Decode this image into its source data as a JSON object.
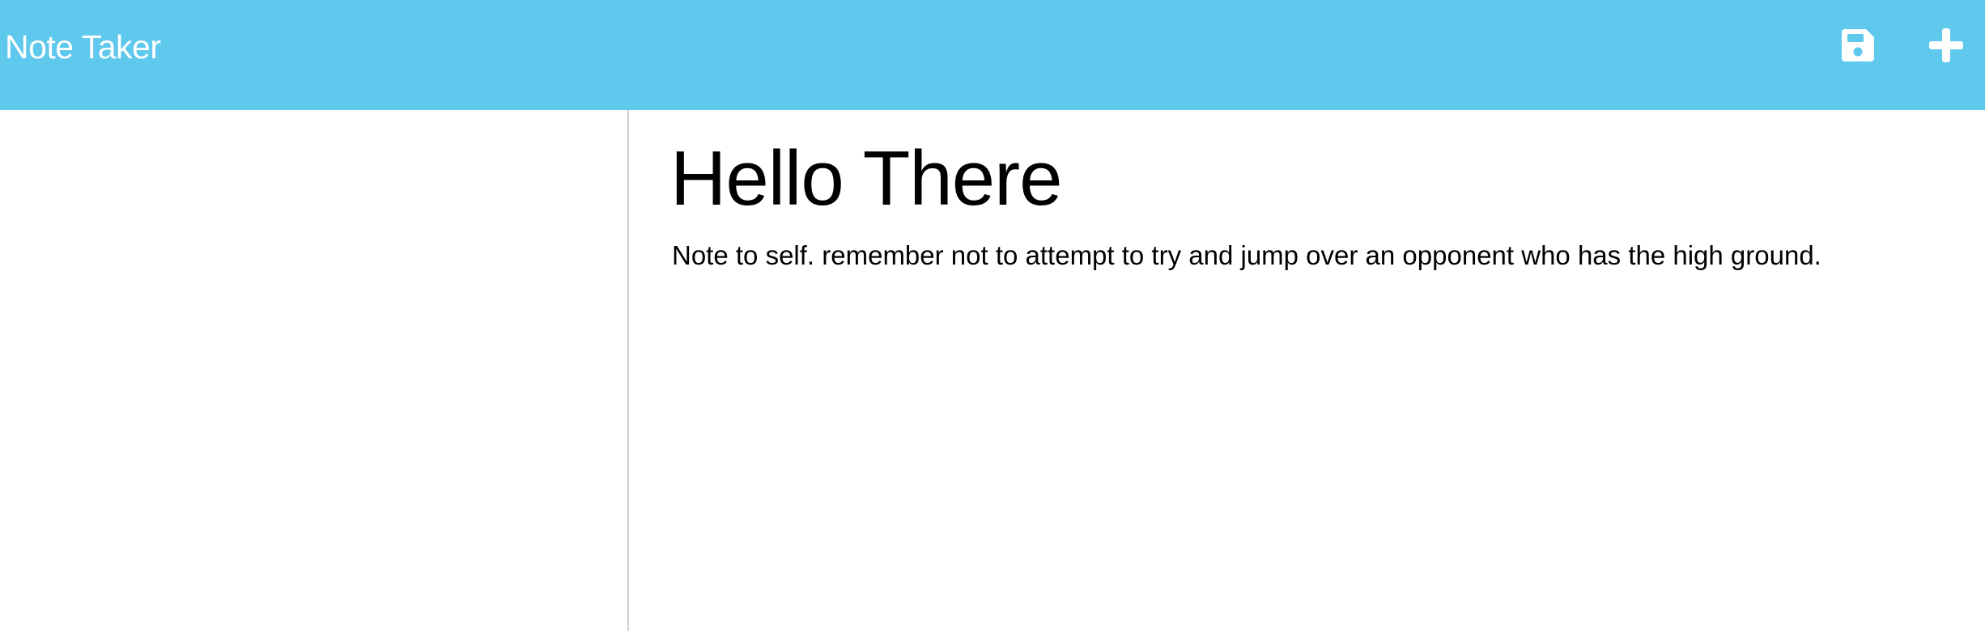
{
  "navbar": {
    "app_title": "Note Taker",
    "background": "#5ec8ed",
    "actions": [
      {
        "name": "save",
        "icon": "floppy-disk-icon"
      },
      {
        "name": "add",
        "icon": "plus-icon"
      }
    ]
  },
  "note": {
    "title": "Hello There",
    "text": "Note to self. remember not to attempt to try and jump over an opponent who has the high ground."
  }
}
